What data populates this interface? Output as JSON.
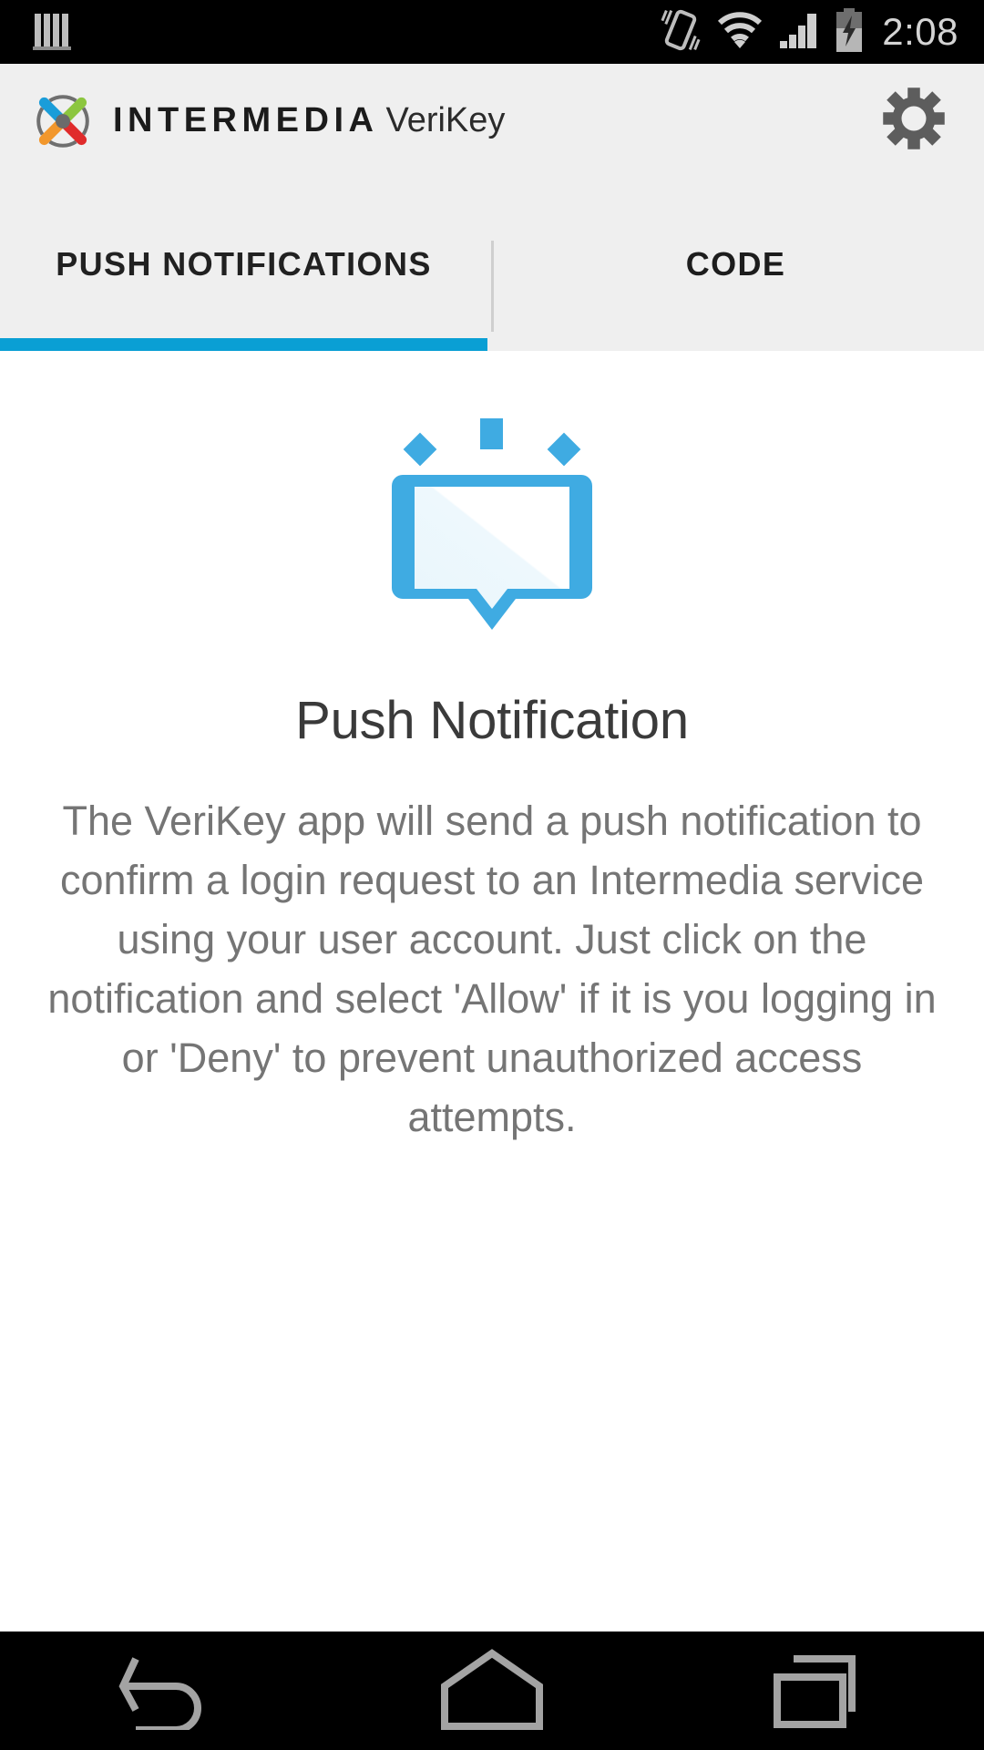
{
  "status_bar": {
    "time": "2:08",
    "icons": [
      "sim-signal-icon",
      "vibrate-icon",
      "wifi-icon",
      "cellular-signal-icon",
      "battery-charging-icon"
    ],
    "background": "#000000",
    "foreground": "#bdbdbd"
  },
  "app_bar": {
    "brand_primary": "INTERMEDIA",
    "brand_secondary": "VeriKey",
    "settings_icon": "gear-icon",
    "background": "#efefef",
    "logo_colors": {
      "blue": "#1a9dd9",
      "green": "#8cc63f",
      "orange": "#f2972c",
      "red": "#e02b2b",
      "center": "#6b6b6b",
      "ring": "#6f6f6f"
    }
  },
  "tabs": {
    "items": [
      {
        "label": "PUSH NOTIFICATIONS",
        "active": true
      },
      {
        "label": "CODE",
        "active": false
      }
    ],
    "active_index": 0,
    "indicator_color": "#0a9fd4",
    "divider_color": "#cfcfcf"
  },
  "main": {
    "illustration": "push-notification-bubble-icon",
    "illustration_color": "#45b0e3",
    "title": "Push Notification",
    "body": "The VeriKey app will send a push notification to confirm a login request to an Intermedia service using your user account. Just click on the notification and select 'Allow' if it is you logging in or 'Deny' to prevent unauthorized access attempts.",
    "title_color": "#3a3a3a",
    "body_color": "#757575"
  },
  "nav_bar": {
    "buttons": [
      {
        "name": "back-button",
        "icon": "back-arrow-icon"
      },
      {
        "name": "home-button",
        "icon": "home-icon"
      },
      {
        "name": "recents-button",
        "icon": "recents-icon"
      }
    ],
    "background": "#000000",
    "icon_color": "#a0a0a0"
  }
}
